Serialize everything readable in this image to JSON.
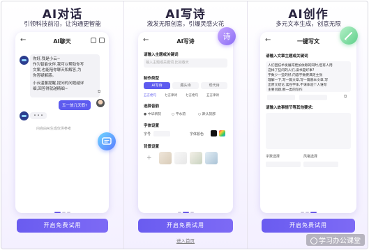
{
  "panels": [
    {
      "title": "AI对话",
      "subtitle": "引领科技前沿，让沟通更智能",
      "screen_title": "AI聊天",
      "greeting": "你好,我是小云~",
      "intro_line1": "作为智能伙伴,我可以帮助你写",
      "intro_line2": "文案,也能陪你聊天和解答,为",
      "intro_line3": "你答疑解惑。",
      "tips_line1": "小云温馨提醒,提问的问题越详",
      "tips_line2": "细,回答得就越精细~",
      "user_message": "五一放几天假?",
      "typing": "• • •",
      "footer_hint": "内容由AI生成仅供参考",
      "cta": "开启免费试用"
    },
    {
      "title": "AI写诗",
      "subtitle": "激发无限创意，引爆灵感火花",
      "screen_title": "AI写诗",
      "theme_label": "请输入主题或关键词",
      "theme_placeholder": "输入主题或关键词,比如春天",
      "type_label": "制作类型",
      "types": [
        "AI写诗",
        "藏头诗",
        "现代诗"
      ],
      "forms": [
        "五言绝句",
        "七言律诗",
        "七言绝句",
        "五言律诗"
      ],
      "voice_label": "选择音韵",
      "voices": [
        "中华新韵",
        "平水韵",
        "默认韵部"
      ],
      "font_label": "字体设置",
      "font_size_label": "字号",
      "font_family_label": "字体颜色",
      "bg_label": "背景设置",
      "plus": "+",
      "cta": "开启免费试用",
      "enter": "进入首页"
    },
    {
      "title": "AI创作",
      "subtitle": "多元文本生成，创意无限",
      "screen_title": "一键写文",
      "input_label": "请输入文章主题或关键词",
      "input_text_1": "人们因技术发展得更加依赖的同时,但有人用",
      "input_text_2": "这样了些问的人们,读书是好事?",
      "input_text_3": "字数少一些的好,内容字数要满足主张",
      "input_text_4": "理解一下,写一篇文章,写一篇基本文章,写",
      "input_text_5": "出原文结论,读在学体,不请体验个人谁写",
      "input_text_6": "主要问题,那一类的写作",
      "story_label": "请输入故事情节等其他要求:",
      "word_count_label": "字数选择",
      "style_label": "风格选择",
      "cta": "开启免费试用"
    }
  ],
  "watermark": "学习办公课堂",
  "colors": {
    "accent": "#5d5bef",
    "title": "#2a2540"
  }
}
